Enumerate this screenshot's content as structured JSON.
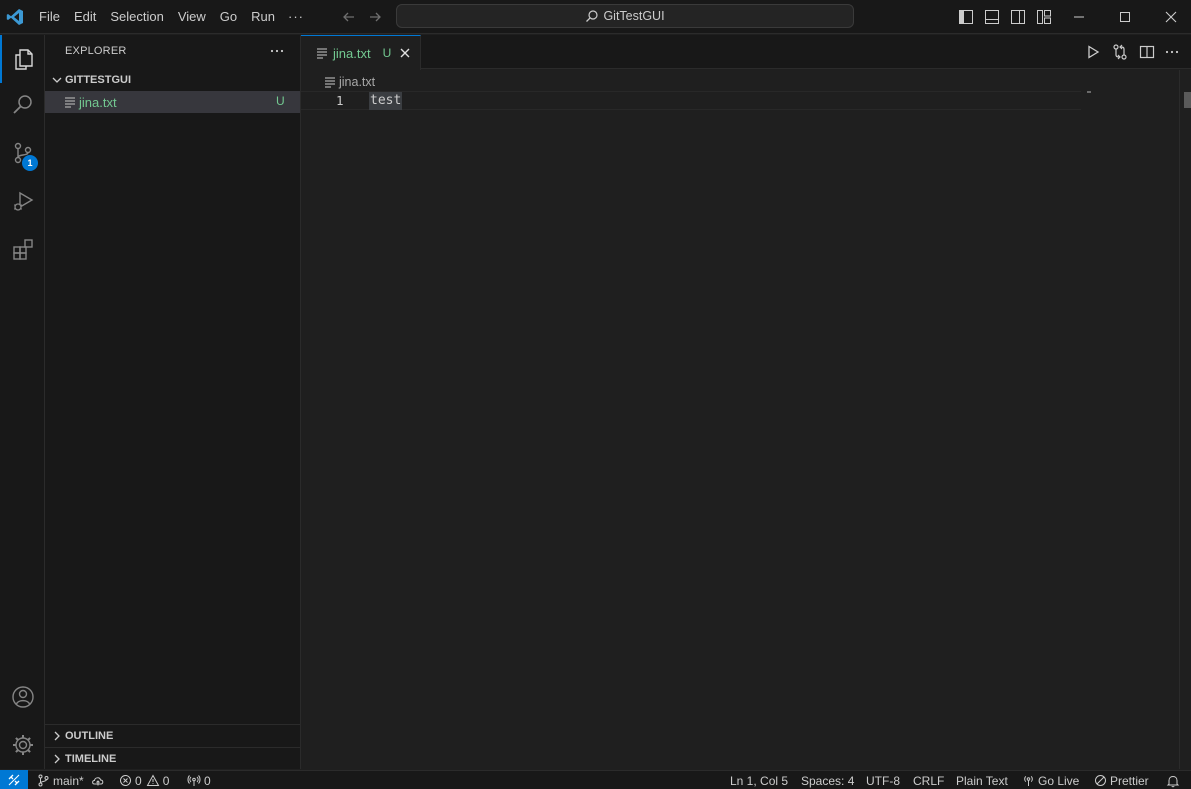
{
  "titlebar": {
    "menu": [
      "File",
      "Edit",
      "Selection",
      "View",
      "Go",
      "Run"
    ],
    "menu_more": "···",
    "command_center": "GitTestGUI"
  },
  "activity": {
    "source_control_badge": "1"
  },
  "sidebar": {
    "header": "EXPLORER",
    "more": "···",
    "folder": "GITTESTGUI",
    "files": [
      {
        "name": "jina.txt",
        "status": "U"
      }
    ],
    "outline": "OUTLINE",
    "timeline": "TIMELINE"
  },
  "editor": {
    "tab": {
      "name": "jina.txt",
      "status": "U"
    },
    "breadcrumb": "jina.txt",
    "lines": [
      {
        "number": "1",
        "text": "test"
      }
    ]
  },
  "statusbar": {
    "branch": "main*",
    "errors": "0",
    "warnings": "0",
    "ports": "0",
    "position": "Ln 1, Col 5",
    "spaces": "Spaces: 4",
    "encoding": "UTF-8",
    "eol": "CRLF",
    "language": "Plain Text",
    "golive": "Go Live",
    "prettier": "Prettier"
  },
  "colors": {
    "accent": "#0078d4",
    "untracked_green": "#73c991",
    "background": "#1f1f1f",
    "chrome": "#181818"
  }
}
